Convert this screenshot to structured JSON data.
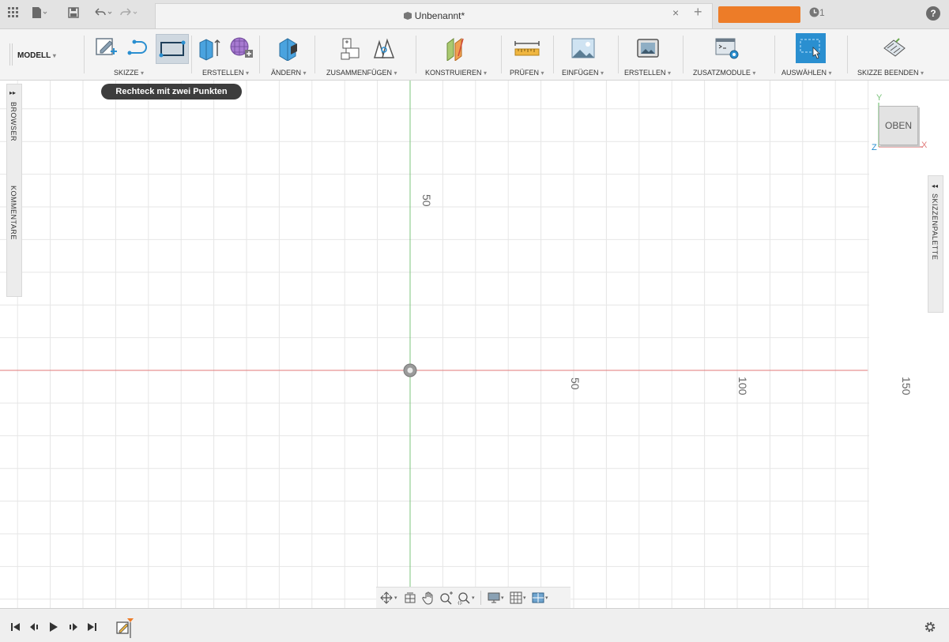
{
  "titlebar": {
    "document_title": "Unbenannt*",
    "close_symbol": "×",
    "new_tab_symbol": "+",
    "job_status_count": "1",
    "help_symbol": "?"
  },
  "toolbar": {
    "workspace": "MODELL",
    "groups": [
      {
        "label": "SKIZZE"
      },
      {
        "label": "ERSTELLEN"
      },
      {
        "label": "ÄNDERN"
      },
      {
        "label": "ZUSAMMENFÜGEN"
      },
      {
        "label": "KONSTRUIEREN"
      },
      {
        "label": "PRÜFEN"
      },
      {
        "label": "EINFÜGEN"
      },
      {
        "label": "ERSTELLEN"
      },
      {
        "label": "ZUSATZMODULE"
      },
      {
        "label": "AUSWÄHLEN"
      },
      {
        "label": "SKIZZE BEENDEN"
      }
    ],
    "dropdown_caret": "▾"
  },
  "tooltip": "Rechteck mit zwei Punkten",
  "side_panels": {
    "browser": "BROWSER",
    "comments": "KOMMENTARE",
    "sketch_palette": "SKIZZENPALETTE",
    "expand_right": "▸▸",
    "expand_left": "◂◂"
  },
  "viewcube": {
    "face": "OBEN",
    "axis_y": "Y",
    "axis_x": "X",
    "axis_z": "Z"
  },
  "grid_labels": {
    "y_50": "50",
    "x_50": "50",
    "x_100": "100",
    "x_150": "150"
  },
  "colors": {
    "accent_orange": "#ed7c28",
    "select_blue": "#2a8fd0",
    "x_axis": "#e07a7a",
    "y_axis": "#7cc47c"
  }
}
